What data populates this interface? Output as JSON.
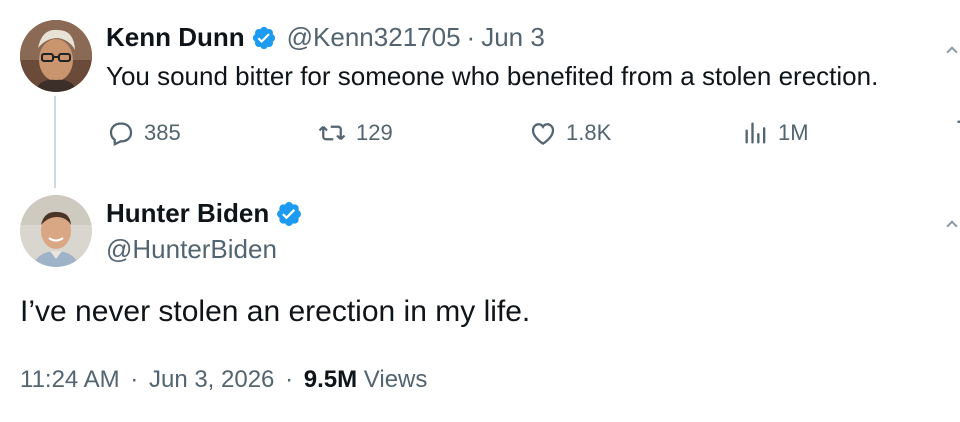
{
  "reply_tweet": {
    "author_name": "Kenn Dunn",
    "handle": "@Kenn321705",
    "separator": "·",
    "date": "Jun 3",
    "text": "You sound bitter for someone who benefited from a stolen erection.",
    "replies": "385",
    "retweets": "129",
    "likes": "1.8K",
    "views": "1M"
  },
  "main_tweet": {
    "author_name": "Hunter Biden",
    "handle": "@HunterBiden",
    "text": "I’ve never stolen an erection in my life.",
    "time": "11:24 AM",
    "sep1": "·",
    "date": "Jun 3, 2026",
    "sep2": "·",
    "views_count": "9.5M",
    "views_label": "Views"
  },
  "colors": {
    "verified_blue": "#1d9bf0",
    "muted_text": "#536471",
    "primary_text": "#0f1419",
    "thread_line": "#cfd9de"
  },
  "icons": [
    "verified-badge-icon",
    "reply-icon",
    "retweet-icon",
    "like-icon",
    "views-icon",
    "bookmark-icon",
    "more-icon"
  ]
}
